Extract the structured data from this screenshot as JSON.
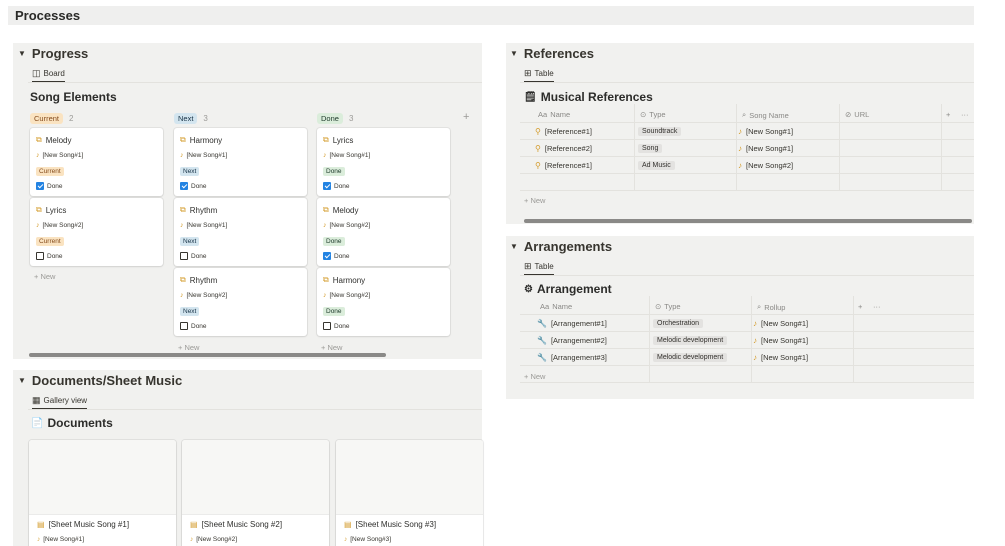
{
  "page": {
    "title": "Processes"
  },
  "icons": {
    "song": "♪",
    "element": "puzzle-icon",
    "reference": "pin-icon",
    "arrangement": "wrench-icon",
    "sheet": "sheet-icon"
  },
  "colors": {
    "current_bg": "#fae3c1",
    "next_bg": "#d3e5ef",
    "done_bg": "#dbeddb",
    "checkbox": "#2383e2"
  },
  "progress": {
    "heading": "Progress",
    "view_tab": "Board",
    "db_title": "Song Elements",
    "add": "+",
    "new_label": "+ New",
    "columns": [
      {
        "label": "Current",
        "count": "2",
        "status": "current",
        "cards": [
          {
            "title": "Melody",
            "song": "[New Song#1]",
            "status": "Current",
            "done_label": "Done",
            "done": true
          },
          {
            "title": "Lyrics",
            "song": "[New Song#2]",
            "status": "Current",
            "done_label": "Done",
            "done": false
          }
        ],
        "new": "+ New"
      },
      {
        "label": "Next",
        "count": "3",
        "status": "next",
        "cards": [
          {
            "title": "Harmony",
            "song": "[New Song#1]",
            "status": "Next",
            "done_label": "Done",
            "done": true
          },
          {
            "title": "Rhythm",
            "song": "[New Song#1]",
            "status": "Next",
            "done_label": "Done",
            "done": false
          },
          {
            "title": "Rhythm",
            "song": "[New Song#2]",
            "status": "Next",
            "done_label": "Done",
            "done": false
          }
        ],
        "new": "+ New"
      },
      {
        "label": "Done",
        "count": "3",
        "status": "done",
        "cards": [
          {
            "title": "Lyrics",
            "song": "[New Song#1]",
            "status": "Done",
            "done_label": "Done",
            "done": true
          },
          {
            "title": "Melody",
            "song": "[New Song#2]",
            "status": "Done",
            "done_label": "Done",
            "done": true
          },
          {
            "title": "Harmony",
            "song": "[New Song#2]",
            "status": "Done",
            "done_label": "Done",
            "done": false
          }
        ],
        "new": "+ New"
      }
    ]
  },
  "references": {
    "heading": "References",
    "view_tab": "Table",
    "db_title": "Musical References",
    "columns": [
      "Name",
      "Type",
      "Song Name",
      "URL"
    ],
    "col_icons": [
      "Aa",
      "⊙",
      "⌕",
      "⊘"
    ],
    "add": "+",
    "more": "···",
    "rows": [
      {
        "name": "[Reference#1]",
        "type": "Soundtrack",
        "song": "[New Song#1]"
      },
      {
        "name": "[Reference#2]",
        "type": "Song",
        "song": "[New Song#1]"
      },
      {
        "name": "[Reference#1]",
        "type": "Ad Music",
        "song": "[New Song#2]"
      }
    ],
    "new": "+ New"
  },
  "arrangements": {
    "heading": "Arrangements",
    "view_tab": "Table",
    "db_title": "Arrangement",
    "columns": [
      "Name",
      "Type",
      "Rollup"
    ],
    "col_icons": [
      "Aa",
      "⊙",
      "⌕"
    ],
    "add": "+",
    "more": "···",
    "rows": [
      {
        "name": "[Arrangement#1]",
        "type": "Orchestration",
        "song": "[New Song#1]"
      },
      {
        "name": "[Arrangement#2]",
        "type": "Melodic development",
        "song": "[New Song#1]"
      },
      {
        "name": "[Arrangement#3]",
        "type": "Melodic development",
        "song": "[New Song#1]"
      }
    ],
    "new": "+ New"
  },
  "documents": {
    "heading": "Documents/Sheet Music",
    "view_tab": "Gallery view",
    "db_title": "Documents",
    "cards": [
      {
        "title": "[Sheet Music Song #1]",
        "song": "[New Song#1]"
      },
      {
        "title": "[Sheet Music Song #2]",
        "song": "[New Song#2]"
      },
      {
        "title": "[Sheet Music Song #3]",
        "song": "[New Song#3]"
      }
    ]
  }
}
